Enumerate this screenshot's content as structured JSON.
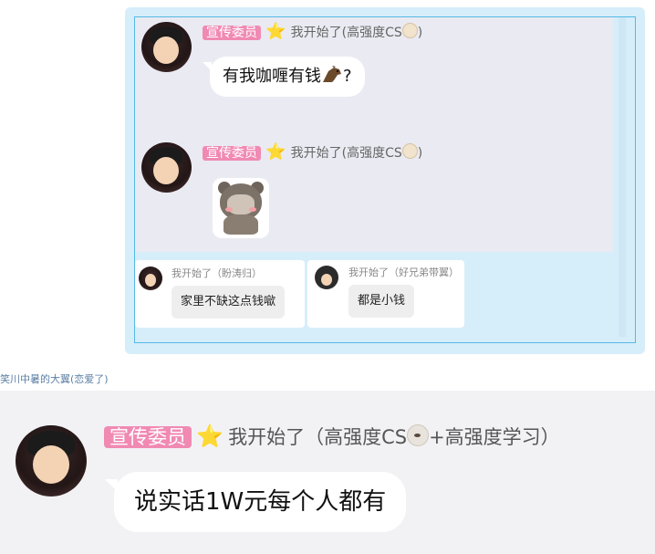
{
  "top_card": {
    "messages": [
      {
        "badge": "宣传委员",
        "star": "⭐",
        "nick_prefix": "我开始了(高强度CS",
        "nick_suffix": ")",
        "text": "有我咖喱有钱",
        "text_suffix": "?",
        "emoji_icon": "horse-icon"
      },
      {
        "badge": "宣传委员",
        "star": "⭐",
        "nick_prefix": "我开始了(高强度CS",
        "nick_suffix": ")",
        "sticker": "bear-sticker"
      }
    ],
    "replies": [
      {
        "name": "我开始了（盼涛归）",
        "text": "家里不缺这点钱噷"
      },
      {
        "name": "我开始了（好兄弟带翼）",
        "text": "都是小钱"
      }
    ]
  },
  "sender_name": "笑川中暑的大翼(恋爱了)",
  "bottom_message": {
    "badge": "宣传委员",
    "star": "⭐",
    "nick_prefix": "我开始了（高强度CS",
    "nick_suffix": "+高强度学习）",
    "text": "说实话1W元每个人都有"
  },
  "colors": {
    "card_bg": "#d6eefa",
    "card_border": "#56b9e6",
    "badge_bg": "#f08ab3",
    "chat_bg": "#eaeaf2"
  }
}
